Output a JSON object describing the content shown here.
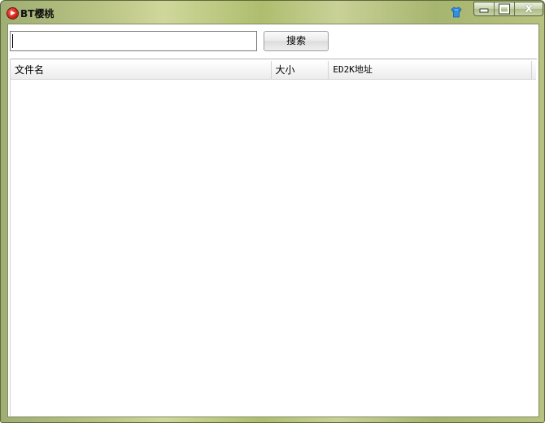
{
  "window": {
    "title": "BT樱桃",
    "controls": {
      "minimize": "minimize",
      "maximize": "maximize",
      "close": "X"
    }
  },
  "search": {
    "value": "",
    "placeholder": "",
    "button_label": "搜索"
  },
  "results": {
    "columns": [
      "文件名",
      "大小",
      "ED2K地址"
    ],
    "rows": []
  },
  "icons": {
    "app": "bt-cherry-app-icon",
    "skin": "skin-shirt-icon"
  },
  "colors": {
    "titlebar_accent": "#b9c383",
    "app_icon_red": "#d5231a",
    "skin_icon_blue": "#2f8fe0"
  }
}
